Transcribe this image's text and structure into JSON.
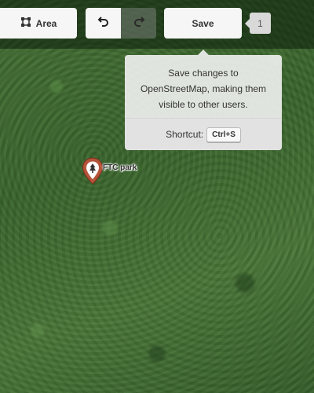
{
  "toolbar": {
    "area_label": "Area",
    "save_label": "Save",
    "edit_count": "1"
  },
  "tooltip": {
    "description": "Save changes to OpenStreetMap, making them visible to other users.",
    "shortcut_label": "Shortcut:",
    "shortcut_key": "Ctrl+S"
  },
  "map": {
    "poi_label": "FTC park",
    "poi_icon": "tree-icon",
    "pin_color": "#b5543a"
  }
}
